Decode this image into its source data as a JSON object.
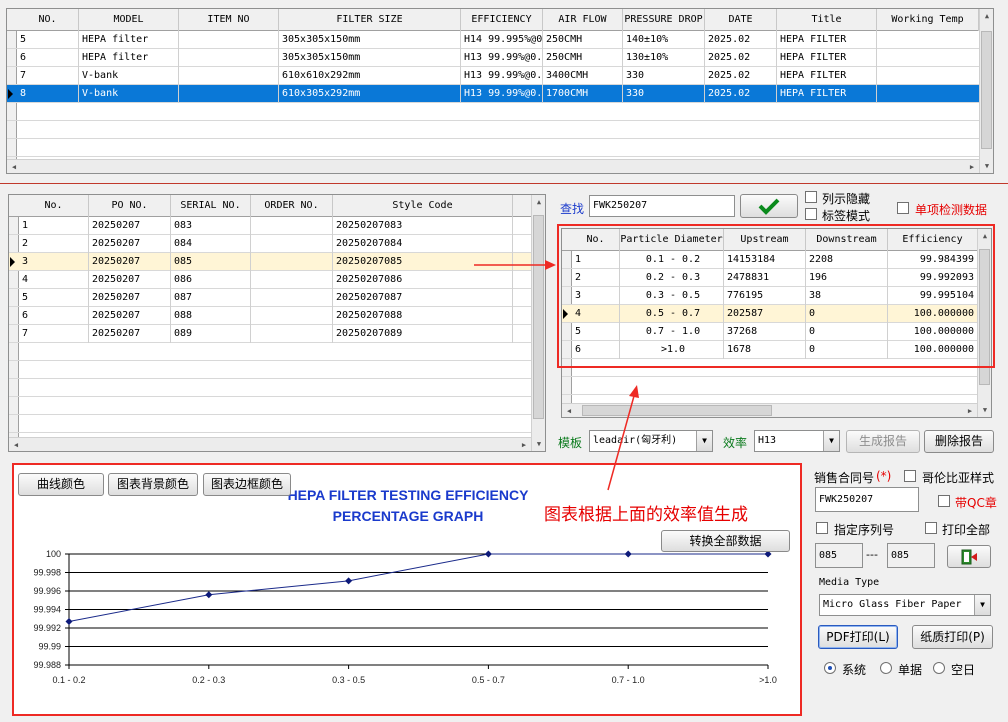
{
  "top_table": {
    "headers": [
      "NO.",
      "MODEL",
      "ITEM NO",
      "FILTER SIZE",
      "EFFICIENCY",
      "AIR FLOW",
      "PRESSURE DROP",
      "DATE",
      "Title",
      "Working Temp"
    ],
    "rows": [
      [
        "5",
        "HEPA filter",
        "",
        "305x305x150mm",
        "H14 99.995%@0.",
        "250CMH",
        "140±10%",
        "2025.02",
        "HEPA FILTER",
        ""
      ],
      [
        "6",
        "HEPA filter",
        "",
        "305x305x150mm",
        "H13 99.99%@0.",
        "250CMH",
        "130±10%",
        "2025.02",
        "HEPA FILTER",
        ""
      ],
      [
        "7",
        "V-bank",
        "",
        "610x610x292mm",
        "H13 99.99%@0.",
        "3400CMH",
        "330",
        "2025.02",
        "HEPA FILTER",
        ""
      ],
      [
        "8",
        "V-bank",
        "",
        "610x305x292mm",
        "H13 99.99%@0.",
        "1700CMH",
        "330",
        "2025.02",
        "HEPA FILTER",
        ""
      ]
    ]
  },
  "po_table": {
    "headers": [
      "No.",
      "PO NO.",
      "SERIAL NO.",
      "ORDER NO.",
      "Style Code"
    ],
    "rows": [
      [
        "1",
        "20250207",
        "083",
        "",
        "20250207083"
      ],
      [
        "2",
        "20250207",
        "084",
        "",
        "20250207084"
      ],
      [
        "3",
        "20250207",
        "085",
        "",
        "20250207085"
      ],
      [
        "4",
        "20250207",
        "086",
        "",
        "20250207086"
      ],
      [
        "5",
        "20250207",
        "087",
        "",
        "20250207087"
      ],
      [
        "6",
        "20250207",
        "088",
        "",
        "20250207088"
      ],
      [
        "7",
        "20250207",
        "089",
        "",
        "20250207089"
      ]
    ]
  },
  "search": {
    "label": "查找",
    "value": "FWK250207"
  },
  "options": {
    "hide_columns": "列示隐藏",
    "label_mode": "标签模式",
    "single_item": "单项检测数据"
  },
  "particle_table": {
    "headers": [
      "No.",
      "Particle Diameter",
      "Upstream",
      "Downstream",
      "Efficiency"
    ],
    "rows": [
      [
        "1",
        "0.1 - 0.2",
        "14153184",
        "2208",
        "99.984399"
      ],
      [
        "2",
        "0.2 - 0.3",
        "2478831",
        "196",
        "99.992093"
      ],
      [
        "3",
        "0.3 - 0.5",
        "776195",
        "38",
        "99.995104"
      ],
      [
        "4",
        "0.5 - 0.7",
        "202587",
        "0",
        "100.000000"
      ],
      [
        "5",
        "0.7 - 1.0",
        "37268",
        "0",
        "100.000000"
      ],
      [
        "6",
        ">1.0",
        "1678",
        "0",
        "100.000000"
      ]
    ]
  },
  "template": {
    "label": "模板",
    "value": "leadair(匈牙利)"
  },
  "efficiency": {
    "label": "效率",
    "value": "H13"
  },
  "buttons": {
    "generate_report": "生成报告",
    "delete_report": "删除报告",
    "curve_color": "曲线颜色",
    "chart_bg_color": "图表背景颜色",
    "chart_border_color": "图表边框颜色",
    "convert_all": "转换全部数据",
    "pdf_print": "PDF打印(L)",
    "paper_print": "纸质打印(P)"
  },
  "annotation": "图表根据上面的效率值生成",
  "sales": {
    "contract_label": "销售合同号",
    "required_mark": "(*)",
    "colombia_style": "哥伦比亚样式",
    "contract_value": "FWK250207",
    "with_qc": "带QC章",
    "specify_serial": "指定序列号",
    "print_all": "打印全部",
    "serial_from": "085",
    "serial_sep": "---",
    "serial_to": "085",
    "media_type_label": "Media Type",
    "media_type_value": "Micro Glass Fiber Paper",
    "radio_system": "系统",
    "radio_single": "单据",
    "radio_blank": "空日"
  },
  "colors": {
    "selection": "#0a78d7",
    "accent_red": "#ee2a24",
    "curve": "#1a2a8a",
    "title_blue": "#1a3acc",
    "highlight_row": "#fff5d6"
  },
  "chart_data": {
    "type": "line",
    "title": "HEPA FILTER TESTING EFFICIENCY PERCENTAGE GRAPH",
    "categories": [
      "0.1 - 0.2",
      "0.2 - 0.3",
      "0.3 - 0.5",
      "0.5 - 0.7",
      "0.7 - 1.0",
      ">1.0"
    ],
    "values": [
      99.9927,
      99.9956,
      99.9971,
      100,
      100,
      100
    ],
    "ylim": [
      99.988,
      100
    ],
    "yticks": [
      "100",
      "99.998",
      "99.996",
      "99.994",
      "99.992",
      "99.99",
      "99.988"
    ],
    "grid": true
  }
}
